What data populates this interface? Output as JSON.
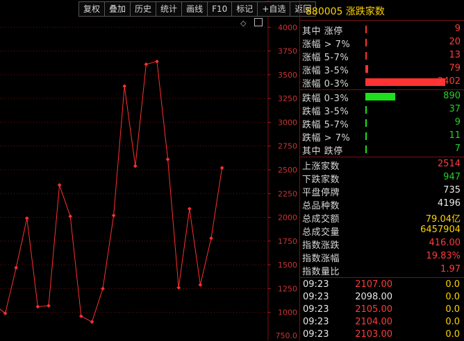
{
  "toolbar": {
    "buttons": [
      "复权",
      "叠加",
      "历史",
      "统计",
      "画线",
      "F10",
      "标记",
      "+自选",
      "返回"
    ]
  },
  "chart_data": {
    "type": "line",
    "color": "#ff3030",
    "yticks": [
      1000,
      1250,
      1500,
      1750,
      2000,
      2250,
      2500,
      2750,
      3000,
      3250,
      3500,
      3750,
      4000
    ],
    "ytick_labels": [
      "1000",
      "1250",
      "1500",
      "1750",
      "2000",
      "2250",
      "2500",
      "2750",
      "3000",
      "3250",
      "3500",
      "3750",
      "4000"
    ],
    "bottom_label": "750.0",
    "ylim": [
      750,
      4250
    ],
    "values": [
      1080,
      990,
      1470,
      1990,
      1060,
      1070,
      2340,
      2010,
      960,
      900,
      1250,
      2020,
      3380,
      2540,
      3610,
      3640,
      2610,
      1260,
      2090,
      1290,
      1780,
      2520
    ]
  },
  "panel": {
    "title": "880005 涨跌家数",
    "rise_rows": [
      {
        "label": "其中 涨停",
        "value": "9",
        "frac": 0.004
      },
      {
        "label": "涨幅 > 7%",
        "value": "20",
        "frac": 0.008
      },
      {
        "label": "涨幅 5-7%",
        "value": "13",
        "frac": 0.006
      },
      {
        "label": "涨幅 3-5%",
        "value": "79",
        "frac": 0.033
      },
      {
        "label": "涨幅 0-3%",
        "value": "2402",
        "frac": 1.0
      }
    ],
    "fall_rows": [
      {
        "label": "跌幅 0-3%",
        "value": "890",
        "frac": 0.37
      },
      {
        "label": "跌幅 3-5%",
        "value": "37",
        "frac": 0.015
      },
      {
        "label": "跌幅 5-7%",
        "value": "9",
        "frac": 0.004
      },
      {
        "label": "跌幅 > 7%",
        "value": "11",
        "frac": 0.005
      },
      {
        "label": "其中 跌停",
        "value": "7",
        "frac": 0.003
      }
    ],
    "stats": [
      {
        "label": "上涨家数",
        "value": "2514",
        "color": "red"
      },
      {
        "label": "下跌家数",
        "value": "947",
        "color": "green"
      },
      {
        "label": "平盘停牌",
        "value": "735",
        "color": "white"
      },
      {
        "label": "总品种数",
        "value": "4196",
        "color": "white"
      },
      {
        "label": "总成交额",
        "value": "79.04亿",
        "color": "yellow"
      },
      {
        "label": "总成交量",
        "value": "6457904",
        "color": "yellow"
      },
      {
        "label": "指数涨跌",
        "value": "416.00",
        "color": "red"
      },
      {
        "label": "指数涨幅",
        "value": "19.83%",
        "color": "red"
      },
      {
        "label": "指数量比",
        "value": "1.97",
        "color": "red"
      }
    ],
    "ticks": [
      {
        "time": "09:23",
        "price": "2107.00",
        "change": "0.0",
        "color": "red"
      },
      {
        "time": "09:23",
        "price": "2098.00",
        "change": "0.0",
        "color": "white"
      },
      {
        "time": "09:23",
        "price": "2105.00",
        "change": "0.0",
        "color": "red"
      },
      {
        "time": "09:23",
        "price": "2104.00",
        "change": "0.0",
        "color": "red"
      },
      {
        "time": "09:23",
        "price": "2103.00",
        "change": "0.0",
        "color": "red"
      }
    ]
  }
}
